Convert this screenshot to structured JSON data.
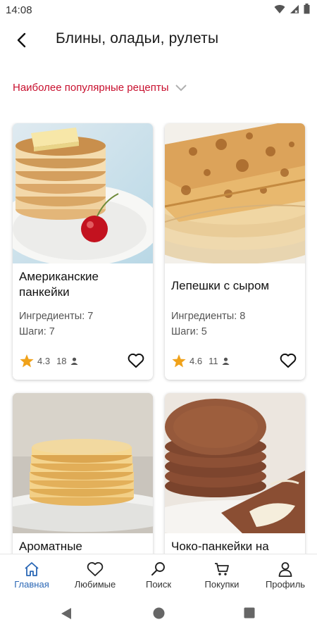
{
  "status": {
    "time": "14:08"
  },
  "header": {
    "title": "Блины,  оладьи,  рулеты"
  },
  "sort": {
    "label": "Наиболее популярные рецепты"
  },
  "recipes": [
    {
      "name": "Американские панкейки",
      "ingredients": "Ингредиенты: 7",
      "steps": "Шаги: 7",
      "rating": "4.3",
      "count": "18"
    },
    {
      "name": "Лепешки с сыром",
      "ingredients": "Ингредиенты: 8",
      "steps": "Шаги: 5",
      "rating": "4.6",
      "count": "11"
    },
    {
      "name": "Ароматные"
    },
    {
      "name": "Чоко-панкейки на"
    }
  ],
  "nav": {
    "home": "Главная",
    "favorites": "Любимые",
    "search": "Поиск",
    "purchases": "Покупки",
    "profile": "Профиль"
  },
  "colors": {
    "accent": "#c8102e",
    "nav_active": "#2a67b5",
    "star": "#f0a21a"
  }
}
